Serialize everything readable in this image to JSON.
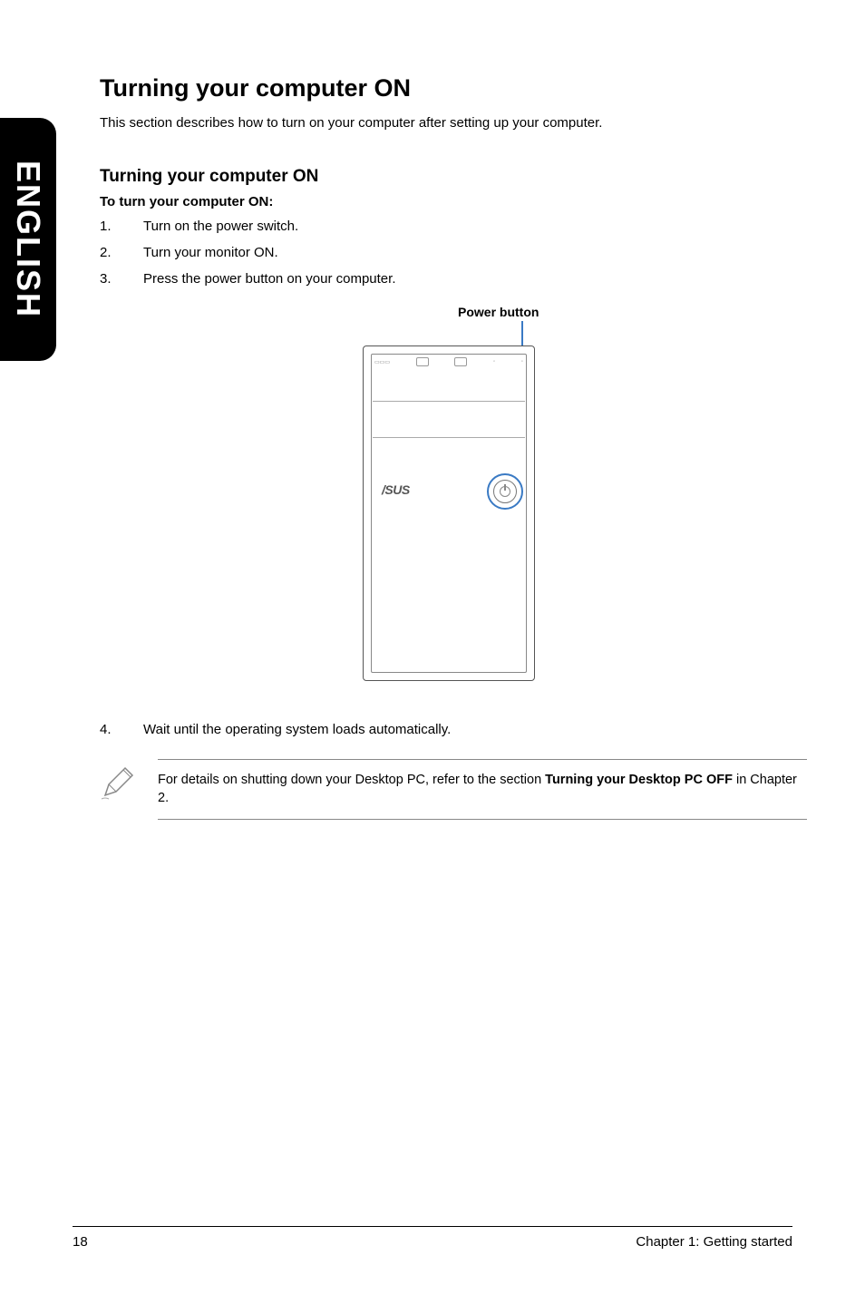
{
  "sideTab": "ENGLISH",
  "mainHeading": "Turning your computer ON",
  "intro": "This section describes how to turn on your computer after setting up your computer.",
  "subHeading": "Turning your computer ON",
  "boldLine": "To turn your computer ON:",
  "steps": [
    {
      "num": "1.",
      "text": "Turn on the power switch."
    },
    {
      "num": "2.",
      "text": "Turn your monitor ON."
    },
    {
      "num": "3.",
      "text": "Press the power button on your computer."
    }
  ],
  "diagram": {
    "powerLabel": "Power button",
    "brand": "/SUS"
  },
  "step4": {
    "num": "4.",
    "text": "Wait until the operating system loads automatically."
  },
  "note": {
    "prefix": "For details on shutting down your Desktop PC, refer to the section ",
    "bold": "Turning your Desktop PC OFF",
    "suffix": " in Chapter 2."
  },
  "footer": {
    "pageNum": "18",
    "chapter": "Chapter 1: Getting started"
  }
}
